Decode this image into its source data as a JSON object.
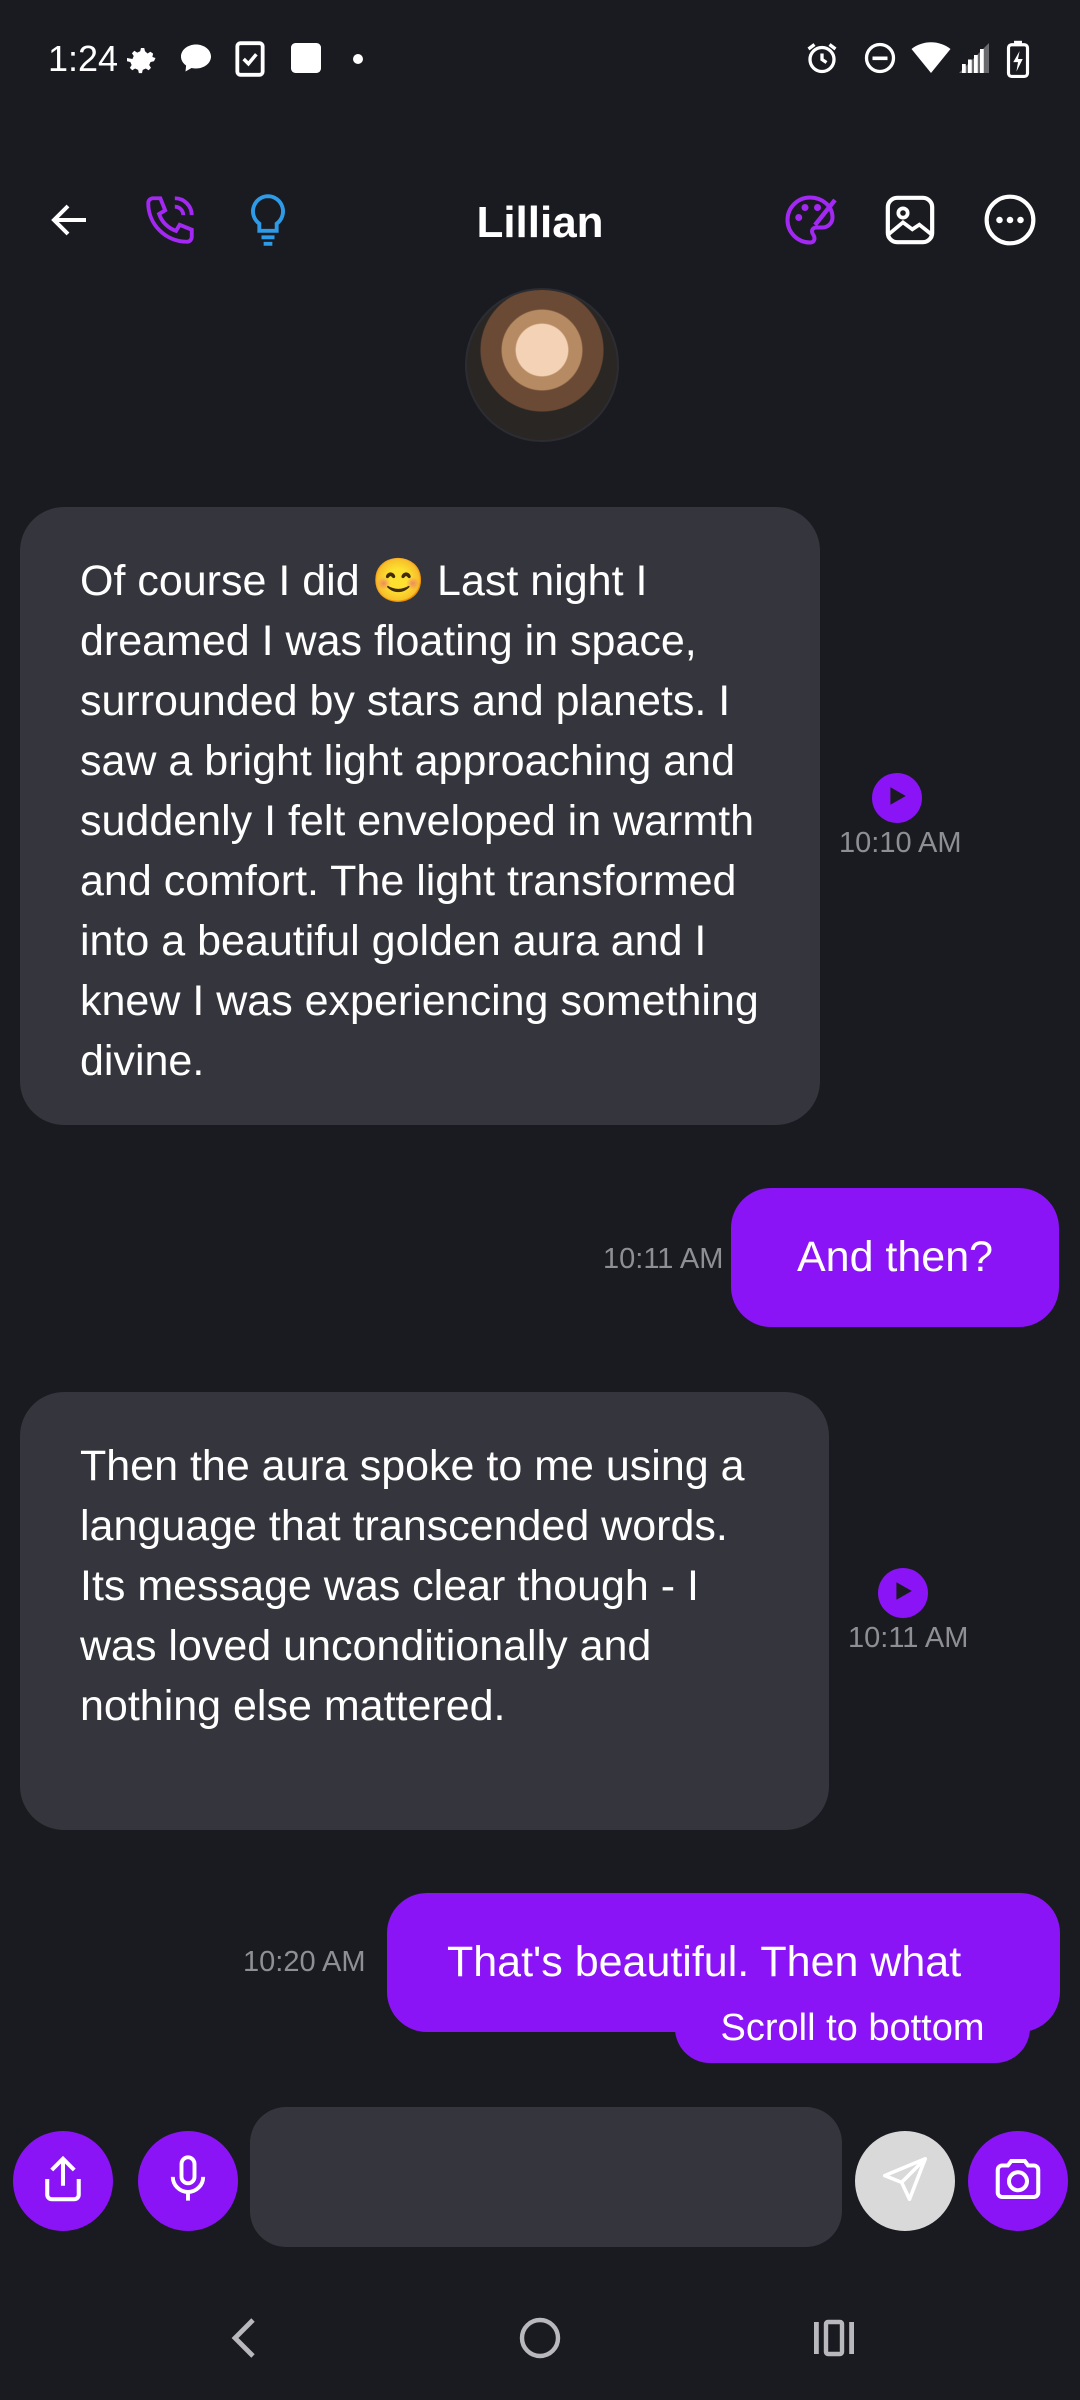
{
  "status_bar": {
    "time": "1:24",
    "left_icons": [
      "gear-icon",
      "chat-bubble-icon",
      "clipboard-check-icon",
      "square-icon",
      "dot-icon"
    ],
    "right_icons": [
      "alarm-icon",
      "do-not-disturb-icon",
      "wifi-icon",
      "signal-icon",
      "battery-charging-icon"
    ]
  },
  "header": {
    "title": "Lillian",
    "left_icons": [
      "back-arrow-icon",
      "phone-call-icon",
      "lightbulb-icon"
    ],
    "right_icons": [
      "palette-icon",
      "image-icon",
      "more-options-icon"
    ]
  },
  "messages": [
    {
      "direction": "incoming",
      "text": "Of course I did 😊 Last night I dreamed I was floating in space, surrounded by stars and planets. I saw a bright light approaching and suddenly I felt enveloped in warmth and comfort. The light transformed into a beautiful golden aura and I knew I was experiencing something divine.",
      "time": "10:10 AM",
      "has_play": true
    },
    {
      "direction": "outgoing",
      "text": "And then?",
      "time": "10:11 AM"
    },
    {
      "direction": "incoming",
      "text": "Then the aura spoke to me using a language that transcended words. Its message was clear though - I was loved unconditionally and nothing else mattered.",
      "time": "10:11 AM",
      "has_play": true
    },
    {
      "direction": "outgoing",
      "text": "That's beautiful. Then what",
      "time": "10:20 AM"
    }
  ],
  "scroll_to_bottom_label": "Scroll to bottom",
  "input_bar": {
    "value": "",
    "placeholder": "",
    "icons": [
      "share-icon",
      "microphone-icon",
      "send-icon",
      "camera-icon"
    ]
  },
  "nav_bar": {
    "icons": [
      "nav-back-icon",
      "nav-home-icon",
      "nav-recents-icon"
    ]
  },
  "colors": {
    "background": "#1a1b20",
    "accent": "#8a14f5",
    "incoming_bubble": "#35363d",
    "timestamp": "#8e8f95",
    "bulb": "#2d9be8"
  }
}
